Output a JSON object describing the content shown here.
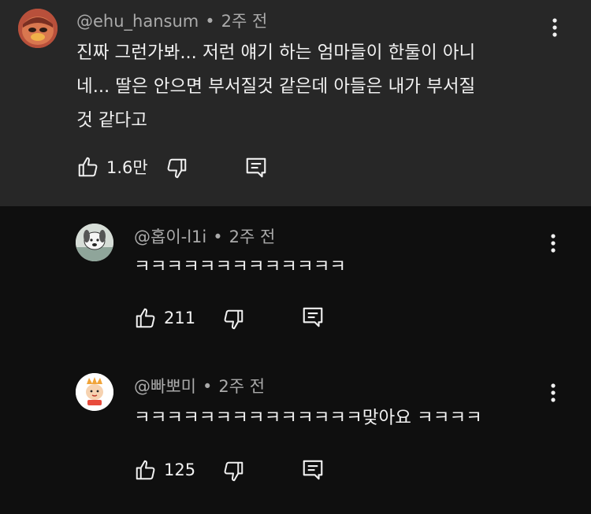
{
  "comments": [
    {
      "author": "@ehu_hansum",
      "time": "2주 전",
      "text": "진짜 그런가봐... 저런 얘기 하는 엄마들이 한둘이 아니\n네... 딸은 안으면 부서질것 같은데 아들은 내가 부서질\n것 같다고",
      "likes": "1.6만",
      "avatar_icon": "duck-avatar-icon"
    },
    {
      "author": "@홉이-l1i",
      "time": "2주 전",
      "text": "ㅋㅋㅋㅋㅋㅋㅋㅋㅋㅋㅋㅋㅋ",
      "likes": "211",
      "avatar_icon": "dog-avatar-icon"
    },
    {
      "author": "@빠뽀미",
      "time": "2주 전",
      "text": "ㅋㅋㅋㅋㅋㅋㅋㅋㅋㅋㅋㅋㅋㅋ맞아요 ㅋㅋㅋㅋ",
      "likes": "125",
      "avatar_icon": "character-avatar-icon"
    }
  ],
  "separator": "•",
  "colors": {
    "top_background": "#272727",
    "page_background": "#0f0f0f",
    "meta_text": "#aaaaaa",
    "main_text": "#f1f1f1"
  }
}
